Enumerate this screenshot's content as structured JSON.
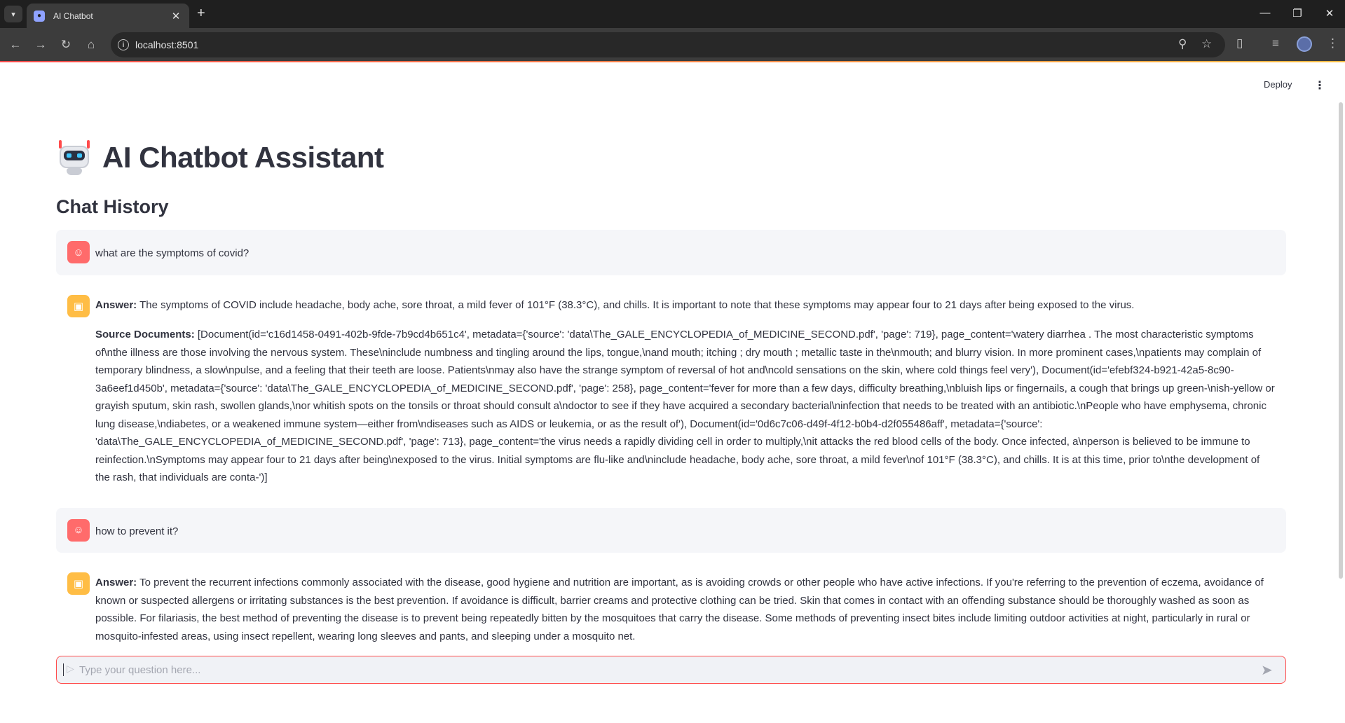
{
  "browser": {
    "tab_title": "AI Chatbot",
    "url": "localhost:8501"
  },
  "app": {
    "deploy_label": "Deploy",
    "title": "AI Chatbot Assistant",
    "section_title": "Chat History",
    "input_placeholder": "Type your question here..."
  },
  "messages": [
    {
      "role": "user",
      "text": "what are the symptoms of covid?"
    },
    {
      "role": "assistant",
      "answer_label": "Answer:",
      "answer": " The symptoms of COVID include headache, body ache, sore throat, a mild fever of 101°F (38.3°C), and chills. It is important to note that these symptoms may appear four to 21 days after being exposed to the virus.",
      "sources_label": "Source Documents:",
      "sources": " [Document(id='c16d1458-0491-402b-9fde-7b9cd4b651c4', metadata={'source': 'data\\The_GALE_ENCYCLOPEDIA_of_MEDICINE_SECOND.pdf', 'page': 719}, page_content='watery diarrhea . The most characteristic symptoms of\\nthe illness are those involving the nervous system. These\\ninclude numbness and tingling around the lips, tongue,\\nand mouth; itching ; dry mouth ; metallic taste in the\\nmouth; and blurry vision. In more prominent cases,\\npatients may complain of temporary blindness, a slow\\npulse, and a feeling that their teeth are loose. Patients\\nmay also have the strange symptom of reversal of hot and\\ncold sensations on the skin, where cold things feel very'), Document(id='efebf324-b921-42a5-8c90-3a6eef1d450b', metadata={'source': 'data\\The_GALE_ENCYCLOPEDIA_of_MEDICINE_SECOND.pdf', 'page': 258}, page_content='fever for more than a few days, difficulty breathing,\\nbluish lips or fingernails, a cough that brings up green-\\nish-yellow or grayish sputum, skin rash, swollen glands,\\nor whitish spots on the tonsils or throat should consult a\\ndoctor to see if they have acquired a secondary bacterial\\ninfection that needs to be treated with an antibiotic.\\nPeople who have emphysema, chronic lung disease,\\ndiabetes, or a weakened immune system—either from\\ndiseases such as AIDS or leukemia, or as the result of'), Document(id='0d6c7c06-d49f-4f12-b0b4-d2f055486aff', metadata={'source': 'data\\The_GALE_ENCYCLOPEDIA_of_MEDICINE_SECOND.pdf', 'page': 713}, page_content='the virus needs a rapidly dividing cell in order to multiply,\\nit attacks the red blood cells of the body. Once infected, a\\nperson is believed to be immune to reinfection.\\nSymptoms may appear four to 21 days after being\\nexposed to the virus. Initial symptoms are flu-like and\\ninclude headache, body ache, sore throat, a mild fever\\nof 101°F (38.3°C), and chills. It is at this time, prior to\\nthe development of the rash, that individuals are conta-')]"
    },
    {
      "role": "user",
      "text": "how to prevent it?"
    },
    {
      "role": "assistant",
      "answer_label": "Answer:",
      "answer": " To prevent the recurrent infections commonly associated with the disease, good hygiene and nutrition are important, as is avoiding crowds or other people who have active infections. If you're referring to the prevention of eczema, avoidance of known or suspected allergens or irritating substances is the best prevention. If avoidance is difficult, barrier creams and protective clothing can be tried. Skin that comes in contact with an offending substance should be thoroughly washed as soon as possible. For filariasis, the best method of preventing the disease is to prevent being repeatedly bitten by the mosquitoes that carry the disease. Some methods of preventing insect bites include limiting outdoor activities at night, particularly in rural or mosquito-infested areas, using insect repellent, wearing long sleeves and pants, and sleeping under a mosquito net."
    }
  ],
  "icons": {
    "user_avatar": "smiley-face-icon",
    "assistant_avatar": "robot-icon",
    "send": "send-arrow-icon"
  },
  "colors": {
    "accent": "#ff4b4b",
    "user_avatar_bg": "#ff6b6b",
    "assistant_avatar_bg": "#ffbd45",
    "user_message_bg": "#f5f6f9",
    "text": "#31333f"
  }
}
